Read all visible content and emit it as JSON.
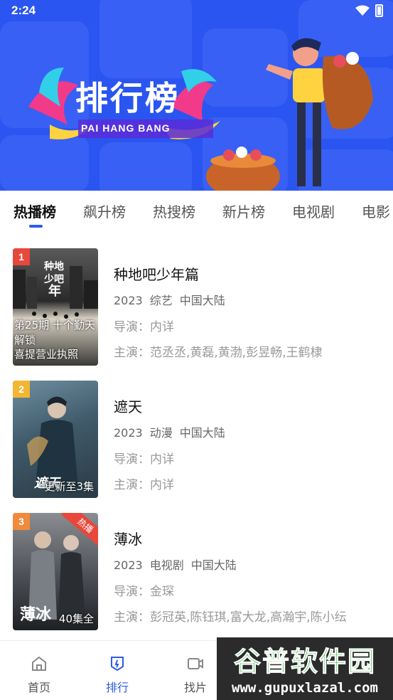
{
  "status_bar": {
    "time": "2:24"
  },
  "banner": {
    "title": "排行榜",
    "subtitle": "PAI HANG BANG",
    "background_color": "#2B55F0"
  },
  "tabs": [
    {
      "label": "热播榜",
      "active": true
    },
    {
      "label": "飙升榜",
      "active": false
    },
    {
      "label": "热搜榜",
      "active": false
    },
    {
      "label": "新片榜",
      "active": false
    },
    {
      "label": "电视剧",
      "active": false
    },
    {
      "label": "电影",
      "active": false
    }
  ],
  "items": [
    {
      "rank": "1",
      "rank_color": "#E8473C",
      "title": "种地吧少年篇",
      "year": "2023",
      "genre": "综艺",
      "region": "中国大陆",
      "director": "导演：内详",
      "cast": "主演：范丞丞,黄磊,黄渤,彭昱畅,王鹤棣",
      "poster_caption_line1": "第25期 十个勤天解锁",
      "poster_caption_line2": "喜提营业执照",
      "poster_title_art": "种地吧少年"
    },
    {
      "rank": "2",
      "rank_color": "#F2B632",
      "title": "遮天",
      "year": "2023",
      "genre": "动漫",
      "region": "中国大陆",
      "director": "导演：内详",
      "cast": "主演：内详",
      "poster_caption": "更新至3集",
      "poster_title_art": "遮天"
    },
    {
      "rank": "3",
      "rank_color": "#F08A3C",
      "title": "薄冰",
      "year": "2023",
      "genre": "电视剧",
      "region": "中国大陆",
      "director": "导演：金琛",
      "cast": "主演：彭冠英,陈钰琪,富大龙,高瀚宇,陈小纭",
      "poster_caption": "40集全",
      "ribbon": "热播",
      "poster_title_art": "薄冰"
    }
  ],
  "bottom_nav": [
    {
      "label": "首页",
      "icon": "home-icon",
      "active": false
    },
    {
      "label": "排行",
      "icon": "ranking-icon",
      "active": true
    },
    {
      "label": "找片",
      "icon": "video-icon",
      "active": false
    }
  ],
  "watermark": {
    "top": "谷普软件园",
    "bottom": "www.gupuxlazal.com"
  }
}
